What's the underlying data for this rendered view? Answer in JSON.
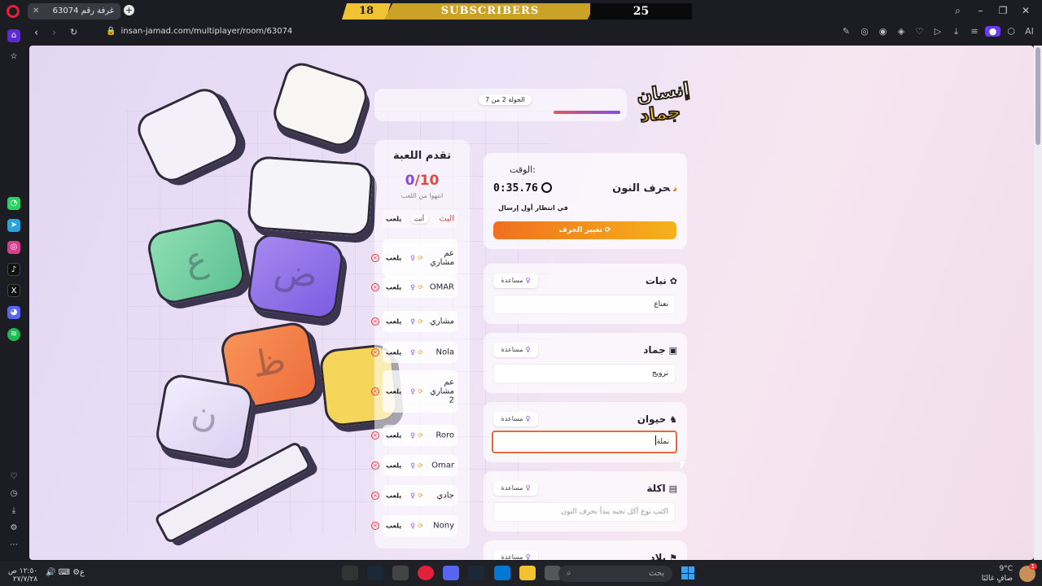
{
  "browser": {
    "tab_title": "غرفة رقم 63074",
    "url": "insan-jamad.com/multiplayer/room/63074",
    "ai_label": "AI"
  },
  "overlay": {
    "left_count": "18",
    "label": "SUBSCRIBERS",
    "right_count": "25"
  },
  "game": {
    "logo_line1": "إنسان",
    "logo_line2": "جماد",
    "round_label": "الجولة 2 من 7",
    "round_progress": 0.2857
  },
  "progress": {
    "title": "تقدم اللعبة",
    "count_done": "0",
    "count_total": "10",
    "subtitle": "انتهوا من اللعب",
    "you_badge": "أنت",
    "players": [
      {
        "name": "البث",
        "status": "يلعب",
        "host": true
      },
      {
        "name": "عم مشاري",
        "status": "يلعب"
      },
      {
        "name": "OMAR",
        "status": "يلعب"
      },
      {
        "name": "مشاري",
        "status": "يلعب"
      },
      {
        "name": "Nola",
        "status": "يلعب"
      },
      {
        "name": "عم مشاري 2",
        "status": "يلعب"
      },
      {
        "name": "Roro",
        "status": "يلعب"
      },
      {
        "name": "Omar",
        "status": "يلعب"
      },
      {
        "name": "جادي",
        "status": "يلعب"
      },
      {
        "name": "Nony",
        "status": "يلعب"
      }
    ]
  },
  "letter": {
    "letter_char": "ن",
    "title": "حرف النون",
    "time_label": "الوقت:",
    "time_value": "0:35.76",
    "waiting": "في انتظار أول إرسال",
    "change_button": "تغيير الحرف"
  },
  "categories": [
    {
      "title": "نبات",
      "icon": "plant-icon",
      "help": "مساعدة",
      "value": "نعناع",
      "placeholder": ""
    },
    {
      "title": "جماد",
      "icon": "box-icon",
      "help": "مساعدة",
      "value": "نرويج",
      "placeholder": ""
    },
    {
      "title": "حيوان",
      "icon": "animal-icon",
      "help": "مساعدة",
      "value": "نملة",
      "placeholder": "",
      "focused": true
    },
    {
      "title": "اكلة",
      "icon": "food-icon",
      "help": "مساعدة",
      "value": "",
      "placeholder": "اكتب نوع أكل تحبه يبدأ بحرف النون"
    },
    {
      "title": "بلاد",
      "icon": "country-icon",
      "help": "مساعدة",
      "value": "",
      "placeholder": ""
    }
  ],
  "taskbar": {
    "search_placeholder": "بحث",
    "weather_temp": "9°C",
    "weather_desc": "صافٍ غالبًا",
    "time": "١٢:٥٠ ص",
    "date": "٢٧/٧/٢٨",
    "lang": "ع",
    "notif_count": "1"
  },
  "colors": {
    "accent_purple": "#8b46e6",
    "accent_orange": "#f07020",
    "danger": "#e2483f"
  }
}
